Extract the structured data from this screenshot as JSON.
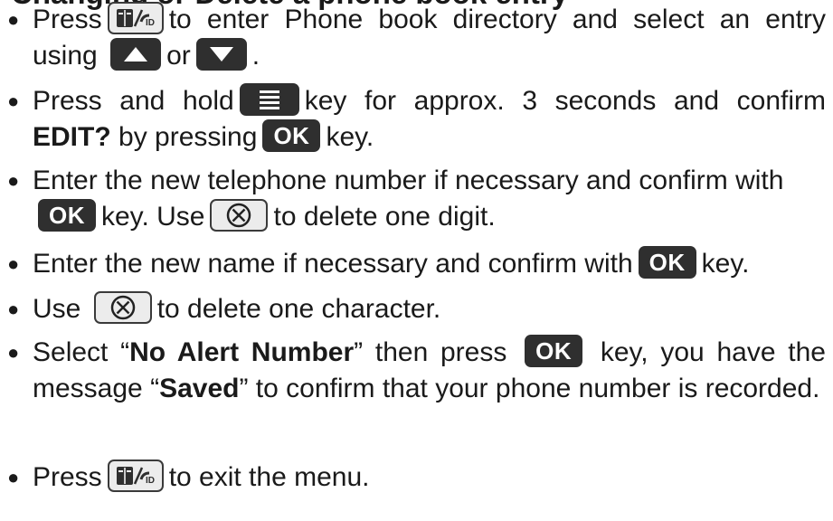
{
  "heading": {
    "partial": "Changing or Delete a phone book entry"
  },
  "keys": {
    "ok_label": "OK"
  },
  "steps": [
    {
      "t1": "Press",
      "t2": "to enter Phone book directory and select an entry using",
      "t3": "or",
      "t4": "."
    },
    {
      "t1": "Press and hold",
      "t2": "key for approx. 3 seconds and confirm",
      "b1": "EDIT?",
      "t3": "by pressing",
      "t4": "key."
    },
    {
      "t1": "Enter the new telephone number if necessary and confirm with",
      "t2": "key. Use",
      "t3": "to delete one digit."
    },
    {
      "t1": "Enter the new name if necessary and confirm with",
      "t2": "key."
    },
    {
      "t1": "Use",
      "t2": "to delete one character."
    },
    {
      "t1": "Select “",
      "b1": "No Alert Number",
      "t2": "” then press",
      "t3": "key, you have the message “",
      "b2": "Saved",
      "t4": "” to confirm that your phone number is recorded."
    },
    {
      "t1": "Press",
      "t2": "to exit the menu."
    }
  ]
}
